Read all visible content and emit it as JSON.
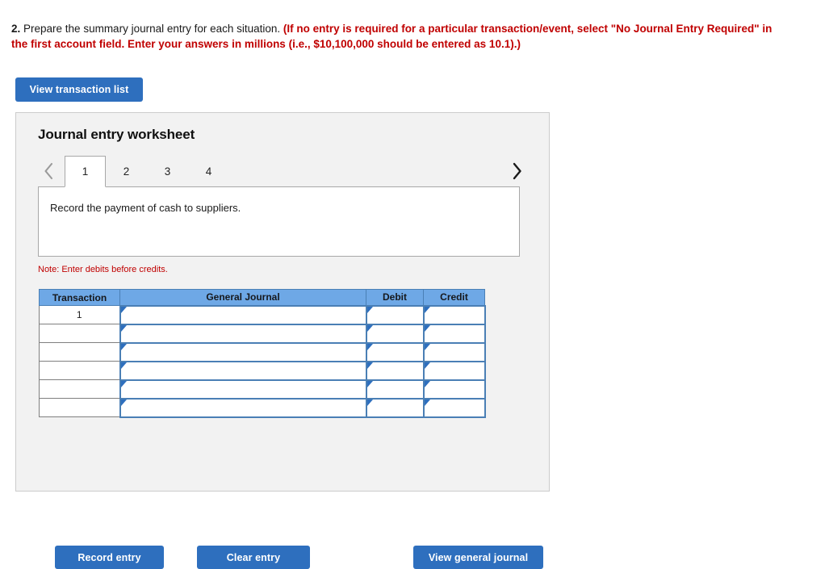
{
  "prompt": {
    "number": "2.",
    "lead": " Prepare the summary journal entry for each situation. ",
    "instruction": "(If no entry is required for a particular transaction/event, select \"No Journal Entry Required\" in the first account field. Enter your answers in millions (i.e., $10,100,000 should be entered as 10.1).)"
  },
  "toolbar": {
    "view_transaction_list": "View transaction list"
  },
  "worksheet": {
    "title": "Journal entry worksheet",
    "prev_icon": "chevron-left-icon",
    "next_icon": "chevron-right-icon",
    "tabs": [
      {
        "label": "1",
        "active": true
      },
      {
        "label": "2",
        "active": false
      },
      {
        "label": "3",
        "active": false
      },
      {
        "label": "4",
        "active": false
      }
    ],
    "description": "Record the payment of cash to suppliers.",
    "note": "Note: Enter debits before credits."
  },
  "journal_table": {
    "headers": [
      "Transaction",
      "General Journal",
      "Debit",
      "Credit"
    ],
    "rows": [
      {
        "transaction": "1",
        "general_journal": "",
        "debit": "",
        "credit": ""
      },
      {
        "transaction": "",
        "general_journal": "",
        "debit": "",
        "credit": ""
      },
      {
        "transaction": "",
        "general_journal": "",
        "debit": "",
        "credit": ""
      },
      {
        "transaction": "",
        "general_journal": "",
        "debit": "",
        "credit": ""
      },
      {
        "transaction": "",
        "general_journal": "",
        "debit": "",
        "credit": ""
      },
      {
        "transaction": "",
        "general_journal": "",
        "debit": "",
        "credit": ""
      }
    ]
  },
  "footer": {
    "record_entry": "Record entry",
    "clear_entry": "Clear entry",
    "view_general_journal": "View general journal"
  },
  "colors": {
    "button_blue": "#2e6fbe",
    "table_header_blue": "#6ea8e6",
    "cell_border_blue": "#4a7fb5",
    "panel_bg": "#f2f2f2",
    "alert_red": "#c00000"
  }
}
